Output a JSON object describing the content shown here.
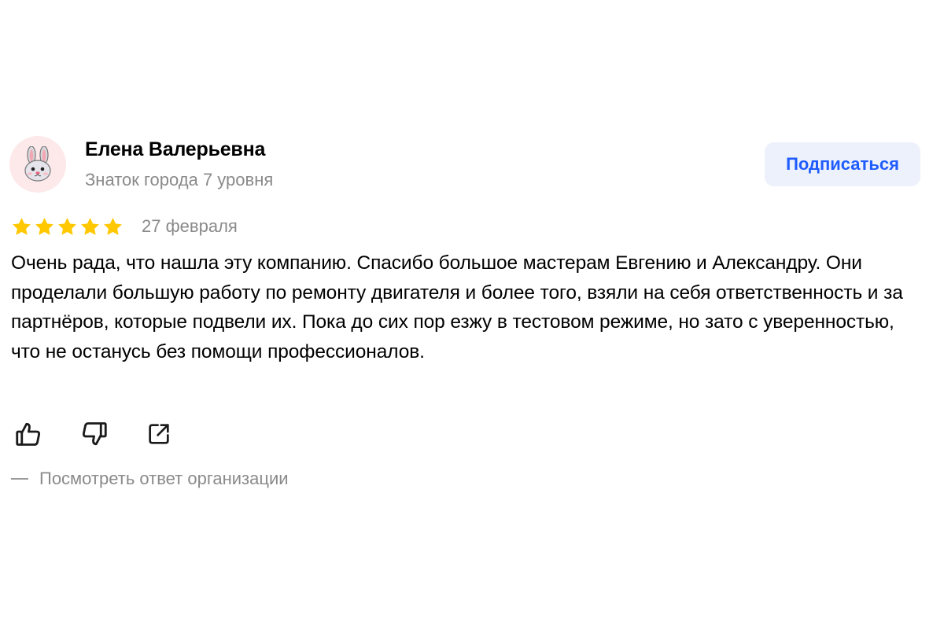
{
  "author": {
    "name": "Елена Валерьевна",
    "level": "Знаток города 7 уровня",
    "avatar_icon": "bunny-face-icon"
  },
  "subscribe": {
    "label": "Подписаться",
    "color": "#1f5cff",
    "background": "#edf1fb"
  },
  "review": {
    "rating": 5,
    "rating_max": 5,
    "date": "27 февраля",
    "text": "Очень рада, что нашла эту компанию. Спасибо большое мастерам Евгению и Александру. Они проделали большую работу по ремонту двигателя и более того, взяли на себя ответственность и за партнёров, которые подвели их. Пока до сих пор езжу в тестовом режиме, но зато с уверенностью, что не останусь без помощи профессионалов."
  },
  "actions": {
    "like_icon": "thumbs-up-icon",
    "dislike_icon": "thumbs-down-icon",
    "share_icon": "share-icon"
  },
  "org_reply": {
    "label": "Посмотреть ответ организации"
  },
  "colors": {
    "star": "#ffc800",
    "muted_text": "#8a8a8a"
  }
}
